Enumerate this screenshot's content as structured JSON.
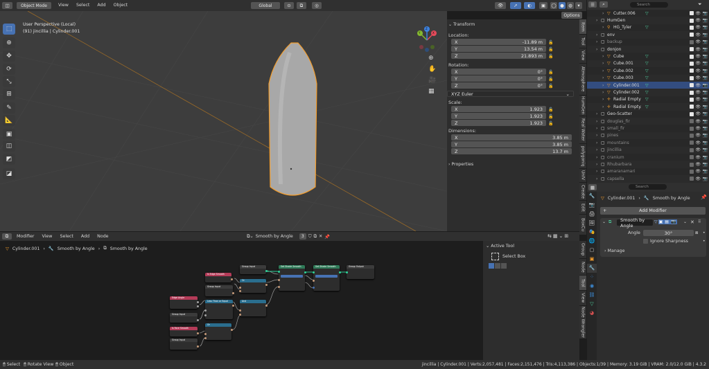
{
  "topbar": {
    "mode": "Object Mode",
    "menus": [
      "View",
      "Select",
      "Add",
      "Object"
    ],
    "orientation": "Global",
    "options": "Options"
  },
  "viewport": {
    "perspective": "User Perspective (Local)",
    "object_info": "(91) jincillia | Cylinder.001",
    "gizmo": {
      "x": "X",
      "y": "Y",
      "z": "Z"
    }
  },
  "npanel": {
    "transform_title": "Transform",
    "location_label": "Location:",
    "location": [
      {
        "axis": "X",
        "value": "-11.89 m"
      },
      {
        "axis": "Y",
        "value": "13.54 m"
      },
      {
        "axis": "Z",
        "value": "21.893 m"
      }
    ],
    "rotation_label": "Rotation:",
    "rotation": [
      {
        "axis": "X",
        "value": "0°"
      },
      {
        "axis": "Y",
        "value": "0°"
      },
      {
        "axis": "Z",
        "value": "0°"
      }
    ],
    "rotation_mode": "XYZ Euler",
    "scale_label": "Scale:",
    "scale": [
      {
        "axis": "X",
        "value": "1.923"
      },
      {
        "axis": "Y",
        "value": "1.923"
      },
      {
        "axis": "Z",
        "value": "1.923"
      }
    ],
    "dimensions_label": "Dimensions:",
    "dimensions": [
      {
        "axis": "X",
        "value": "3.85 m"
      },
      {
        "axis": "Y",
        "value": "3.85 m"
      },
      {
        "axis": "Z",
        "value": "13.7 m"
      }
    ],
    "properties_title": "Properties"
  },
  "side_tabs": [
    "Item",
    "Tool",
    "View",
    "Atmosphere",
    "HumGen",
    "Real Water",
    "polygoniq",
    "UnIV",
    "Create",
    "Edit",
    "BoxCu",
    "Group",
    "Node",
    "Tool",
    "View",
    "Node Wrangler"
  ],
  "outliner": {
    "search_placeholder": "Search",
    "items": [
      {
        "name": "Cutter.006",
        "indent": 2,
        "type": "mesh",
        "active": false,
        "dim": false
      },
      {
        "name": "HumGen",
        "indent": 1,
        "type": "collection",
        "active": false,
        "dim": false
      },
      {
        "name": "HG_Tyler",
        "indent": 2,
        "type": "armature",
        "active": false,
        "dim": false
      },
      {
        "name": "env",
        "indent": 1,
        "type": "collection",
        "active": false,
        "dim": false
      },
      {
        "name": "backup",
        "indent": 1,
        "type": "collection",
        "active": false,
        "dim": true
      },
      {
        "name": "donjon",
        "indent": 1,
        "type": "collection",
        "active": false,
        "dim": false
      },
      {
        "name": "Cube",
        "indent": 2,
        "type": "mesh",
        "active": false,
        "dim": false
      },
      {
        "name": "Cube.001",
        "indent": 2,
        "type": "mesh",
        "active": false,
        "dim": false
      },
      {
        "name": "Cube.002",
        "indent": 2,
        "type": "mesh",
        "active": false,
        "dim": false
      },
      {
        "name": "Cube.003",
        "indent": 2,
        "type": "mesh",
        "active": false,
        "dim": false
      },
      {
        "name": "Cylinder.001",
        "indent": 2,
        "type": "mesh",
        "active": true,
        "dim": false
      },
      {
        "name": "Cylinder.002",
        "indent": 2,
        "type": "mesh",
        "active": false,
        "dim": false
      },
      {
        "name": "Radial Empty",
        "indent": 2,
        "type": "empty",
        "active": false,
        "dim": false
      },
      {
        "name": "Radial Empty.001",
        "indent": 2,
        "type": "empty",
        "active": false,
        "dim": false
      },
      {
        "name": "Geo-Scatter",
        "indent": 1,
        "type": "collection",
        "active": false,
        "dim": false
      },
      {
        "name": "douglas_fir",
        "indent": 1,
        "type": "collection",
        "active": false,
        "dim": true
      },
      {
        "name": "small_fir",
        "indent": 1,
        "type": "collection",
        "active": false,
        "dim": true
      },
      {
        "name": "pines",
        "indent": 1,
        "type": "collection",
        "active": false,
        "dim": true
      },
      {
        "name": "mountains",
        "indent": 1,
        "type": "collection",
        "active": false,
        "dim": true
      },
      {
        "name": "jincillia",
        "indent": 1,
        "type": "collection",
        "active": false,
        "dim": true
      },
      {
        "name": "cranium",
        "indent": 1,
        "type": "collection",
        "active": false,
        "dim": true
      },
      {
        "name": "Rhubarbara",
        "indent": 1,
        "type": "collection",
        "active": false,
        "dim": true
      },
      {
        "name": "amaranamaria",
        "indent": 1,
        "type": "collection",
        "active": false,
        "dim": true
      },
      {
        "name": "capsella",
        "indent": 1,
        "type": "collection",
        "active": false,
        "dim": true
      }
    ]
  },
  "properties": {
    "search_placeholder": "Search",
    "breadcrumb_object": "Cylinder.001",
    "breadcrumb_modifier": "Smooth by Angle",
    "add_modifier": "Add Modifier",
    "modifier_name": "Smooth by Angle",
    "angle_label": "Angle",
    "angle_value": "30°",
    "ignore_sharpness": "Ignore Sharpness",
    "manage": "Manage"
  },
  "node_editor": {
    "menus": [
      "Modifier",
      "View",
      "Select",
      "Add",
      "Node"
    ],
    "node_group": "Smooth by Angle",
    "users": "3",
    "breadcrumb": [
      "Cylinder.001",
      "Smooth by Angle",
      "Smooth by Angle"
    ],
    "active_tool_title": "Active Tool",
    "select_box": "Select Box",
    "nodes": [
      {
        "title": "Group Input",
        "color": "#3b3b3b"
      },
      {
        "title": "Set Shade Smooth",
        "color": "#2f7a58"
      },
      {
        "title": "Set Shade Smooth",
        "color": "#2f7a58"
      },
      {
        "title": "Group Output",
        "color": "#3b3b3b"
      },
      {
        "title": "Is Edge Smooth",
        "color": "#b43b58"
      },
      {
        "title": "Or",
        "color": "#2a6e8e"
      },
      {
        "title": "Group Input",
        "color": "#3b3b3b"
      },
      {
        "title": "Edge Angle",
        "color": "#b43b58"
      },
      {
        "title": "Less Than or Equal",
        "color": "#2a6e8e"
      },
      {
        "title": "And",
        "color": "#2a6e8e"
      },
      {
        "title": "Group Input",
        "color": "#3b3b3b"
      },
      {
        "title": "Is Face Smooth",
        "color": "#b43b58"
      },
      {
        "title": "Or",
        "color": "#2a6e8e"
      },
      {
        "title": "Group Input",
        "color": "#3b3b3b"
      }
    ]
  },
  "statusbar": {
    "select": "Select",
    "rotate_view": "Rotate View",
    "object": "Object",
    "stats": "jincillia | Cylinder.001 | Verts:2,057,481 | Faces:2,151,476 | Tris:4,113,386 | Objects:1/39 | Memory: 3.19 GiB | VRAM: 2.0/12.0 GiB | 4.3.2"
  },
  "colors": {
    "accent": "#4772b3",
    "selection": "#f59e2c",
    "mesh_icon": "#4fd1a0",
    "modifier_icon": "#3d8edb"
  }
}
